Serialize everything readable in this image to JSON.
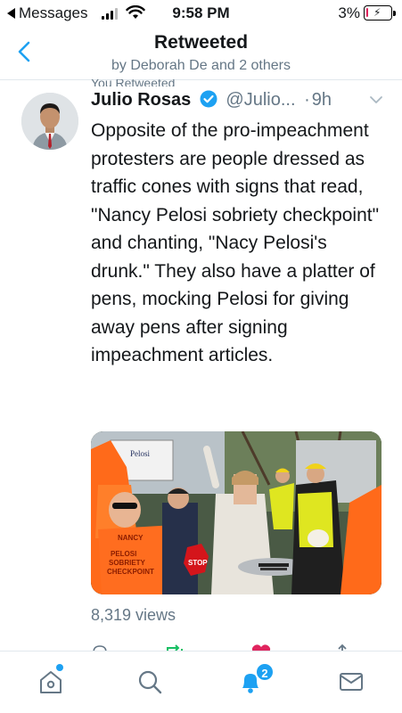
{
  "status_bar": {
    "back_app": "Messages",
    "time": "9:58 PM",
    "battery_pct": "3%"
  },
  "header": {
    "title": "Retweeted",
    "subtitle": "by Deborah De and 2 others"
  },
  "tweet": {
    "context": "You Retweeted",
    "author_name": "Julio Rosas",
    "handle": "@Julio...",
    "time_sep": "·",
    "time": "9h",
    "text": "Opposite of the pro-impeachment protesters are people dressed as traffic cones with signs that read, \"Nancy Pelosi sobriety checkpoint\" and chanting, \"Nacy Pelosi's drunk.\" They also have a platter of pens, mocking Pelosi for giving away pens after signing impeachment articles.",
    "views": "8,319 views",
    "media_sign_lines": [
      "NANCY",
      "PELOSI",
      "SOBRIETY",
      "CHECKPOINT"
    ],
    "media_back_sign": "Pelosi",
    "media_stop": "STOP"
  },
  "tab_bar": {
    "notifications_badge": "2"
  },
  "colors": {
    "accent": "#1da1f2",
    "text": "#14171a",
    "secondary": "#657786",
    "retweet_green": "#17bf63",
    "like_red": "#e0245e"
  }
}
